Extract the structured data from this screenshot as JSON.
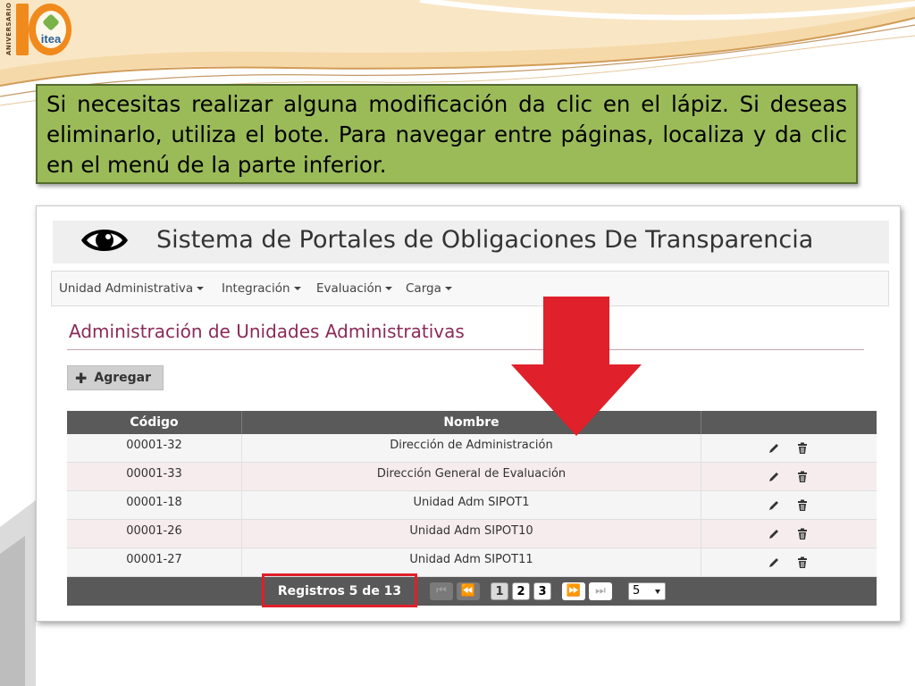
{
  "logo": {
    "text": "itea",
    "vertical_text": "ANIVERSARIO"
  },
  "instruction": {
    "text": "Si necesitas realizar alguna modificación da clic en el lápiz. Si deseas eliminarlo, utiliza el bote. Para navegar entre páginas, localiza y da clic en el menú de la parte inferior."
  },
  "app": {
    "title": "Sistema de Portales de Obligaciones De Transparencia",
    "nav": [
      {
        "label": "Unidad Administrativa"
      },
      {
        "label": "Integración"
      },
      {
        "label": "Evaluación"
      },
      {
        "label": "Carga"
      }
    ],
    "section_title": "Administración de Unidades Administrativas",
    "add_button": "Agregar"
  },
  "table": {
    "headers": [
      "Código",
      "Nombre",
      ""
    ],
    "rows": [
      {
        "codigo": "00001-32",
        "nombre": "Dirección de Administración"
      },
      {
        "codigo": "00001-33",
        "nombre": "Dirección General de Evaluación"
      },
      {
        "codigo": "00001-18",
        "nombre": "Unidad Adm SIPOT1"
      },
      {
        "codigo": "00001-26",
        "nombre": "Unidad Adm SIPOT10"
      },
      {
        "codigo": "00001-27",
        "nombre": "Unidad Adm SIPOT11"
      }
    ]
  },
  "pager": {
    "records": "Registros 5 de 13",
    "pages": [
      "1",
      "2",
      "3"
    ],
    "current_page": "1",
    "page_size": "5"
  },
  "icons": {
    "edit": "pencil-icon",
    "delete": "trash-icon",
    "view": "eye-icon",
    "add": "plus-icon"
  },
  "colors": {
    "instruction_bg": "#9bbb59",
    "section_title": "#8b2a58",
    "table_header": "#5a5a5a",
    "annotation_red": "#e0202a"
  }
}
